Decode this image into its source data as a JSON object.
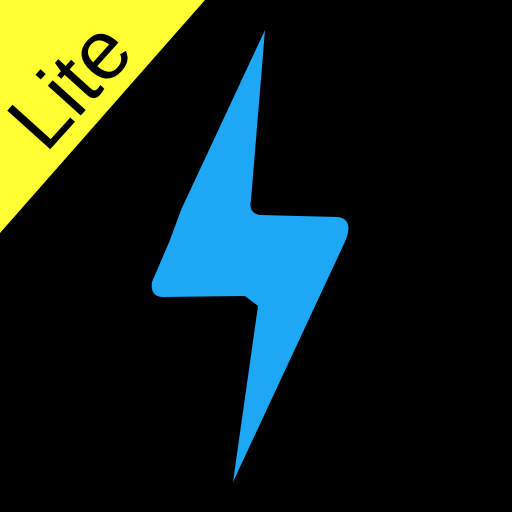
{
  "app_icon": {
    "badge": {
      "label": "Lite"
    },
    "glyph": "lightning-bolt-icon",
    "colors": {
      "background": "#000000",
      "badge": "#FFFF33",
      "badge_text": "#000000",
      "bolt": "#1EA7F5"
    }
  }
}
